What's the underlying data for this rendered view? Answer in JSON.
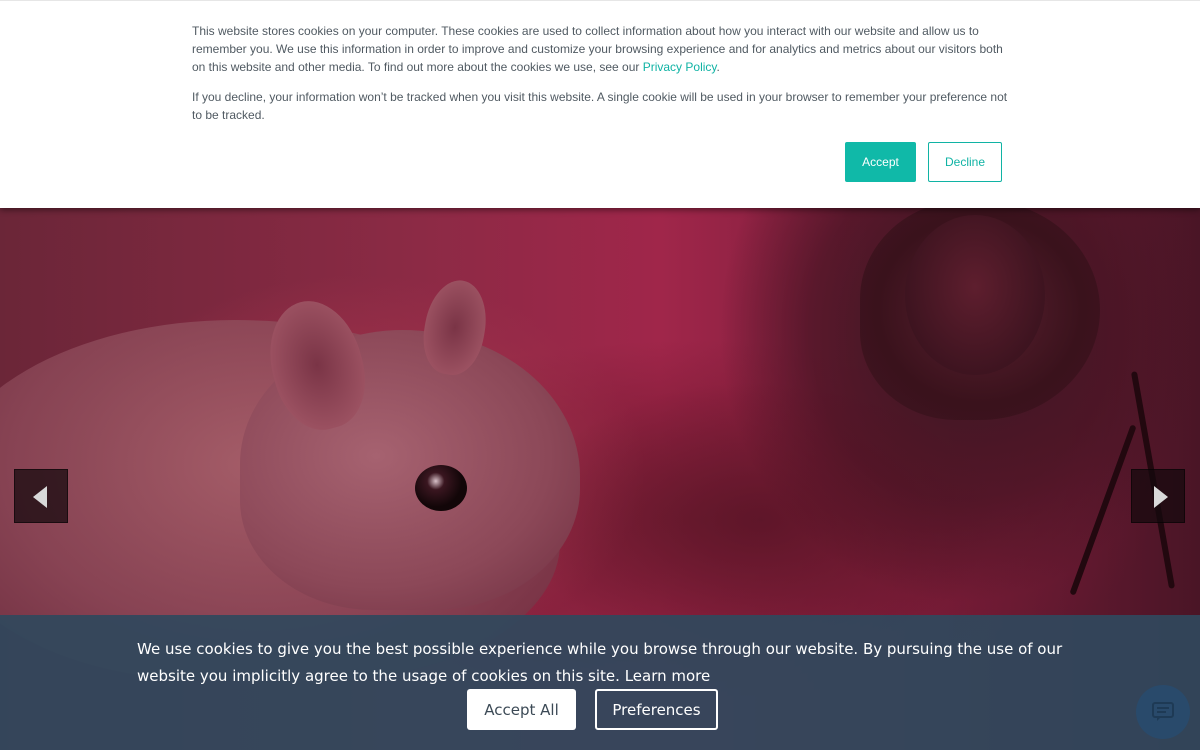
{
  "cookie_notice": {
    "paragraph1_before_link": "This website stores cookies on your computer. These cookies are used to collect information about how you interact with our website and allow us to remember you. We use this information in order to improve and customize your browsing experience and for analytics and metrics about our visitors both on this website and other media. To find out more about the cookies we use, see our ",
    "privacy_link": "Privacy Policy",
    "paragraph1_after_link": ".",
    "paragraph2": "If you decline, your information won’t be tracked when you visit this website. A single cookie will be used in your browser to remember your preference not to be tracked.",
    "accept_label": "Accept",
    "decline_label": "Decline",
    "accent_color": "#10b9a8"
  },
  "slider": {
    "prev_icon": "chevron-left-icon",
    "next_icon": "chevron-right-icon"
  },
  "cookie_bar": {
    "text": "We use cookies to give you the best possible experience while you browse through our website. By pursuing the use of our website you implicitly agree to the usage of cookies on this site.",
    "learn_more": "Learn more",
    "accept_all_label": "Accept All",
    "preferences_label": "Preferences",
    "background_color": "#30485c"
  },
  "chat": {
    "icon": "chat-icon"
  }
}
